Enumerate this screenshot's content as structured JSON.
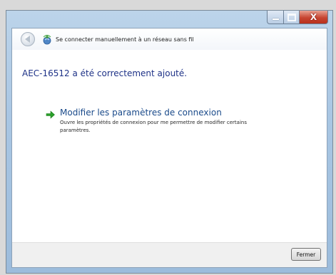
{
  "window": {
    "caption_buttons": {
      "minimize_icon": "minimize-icon",
      "maximize_icon": "maximize-icon",
      "close_icon": "close-icon",
      "close_glyph": "X"
    }
  },
  "navbar": {
    "back_icon": "back-arrow-icon",
    "network_icon": "wireless-network-icon",
    "title": "Se connecter manuellement à un réseau sans fil"
  },
  "main": {
    "heading": "AEC-16512 a été correctement ajouté.",
    "link": {
      "icon": "green-arrow-icon",
      "title": "Modifier les paramètres de connexion",
      "description": "Ouvre les propriétés de connexion pour me permettre de modifier certains paramètres."
    }
  },
  "footer": {
    "close_label": "Fermer"
  },
  "colors": {
    "heading": "#1e3287",
    "link": "#1a4a8a",
    "arrow": "#2aa02a",
    "close_button_red": "#c74531"
  }
}
